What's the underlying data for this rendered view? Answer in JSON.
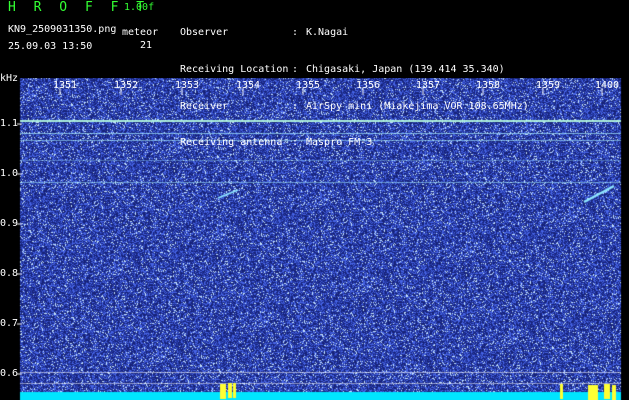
{
  "header": {
    "app_title": "H R O F F T",
    "version": "1.00f",
    "filename": "KN9_2509031350.png",
    "meteor_label": "meteor",
    "meteor_count": "21",
    "datetime": "25.09.03 13:50",
    "info": [
      {
        "key": "Observer",
        "value": "K.Nagai"
      },
      {
        "key": "Receiving Location",
        "value": "Chigasaki, Japan (139.414 35.340)"
      },
      {
        "key": "Receiver",
        "value": "AirSpy mini (Miakejima VOR 108.65MHz)"
      },
      {
        "key": "Receiving antenna",
        "value": "Maspro FM-3"
      }
    ]
  },
  "spectrogram": {
    "freq_unit": "kHz",
    "x_ticks": [
      "1351",
      "1352",
      "1353",
      "1354",
      "1355",
      "1356",
      "1357",
      "1358",
      "1359",
      "1400"
    ],
    "y_ticks": [
      "1.1",
      "1.0",
      "0.9",
      "0.8",
      "0.7",
      "0.6"
    ],
    "colors": {
      "background": "#1c2a8a",
      "noise": "#4a66ff",
      "signal": "#8fe8ff",
      "bottom_band": "#00e5ff",
      "burst": "#ffff33"
    }
  }
}
